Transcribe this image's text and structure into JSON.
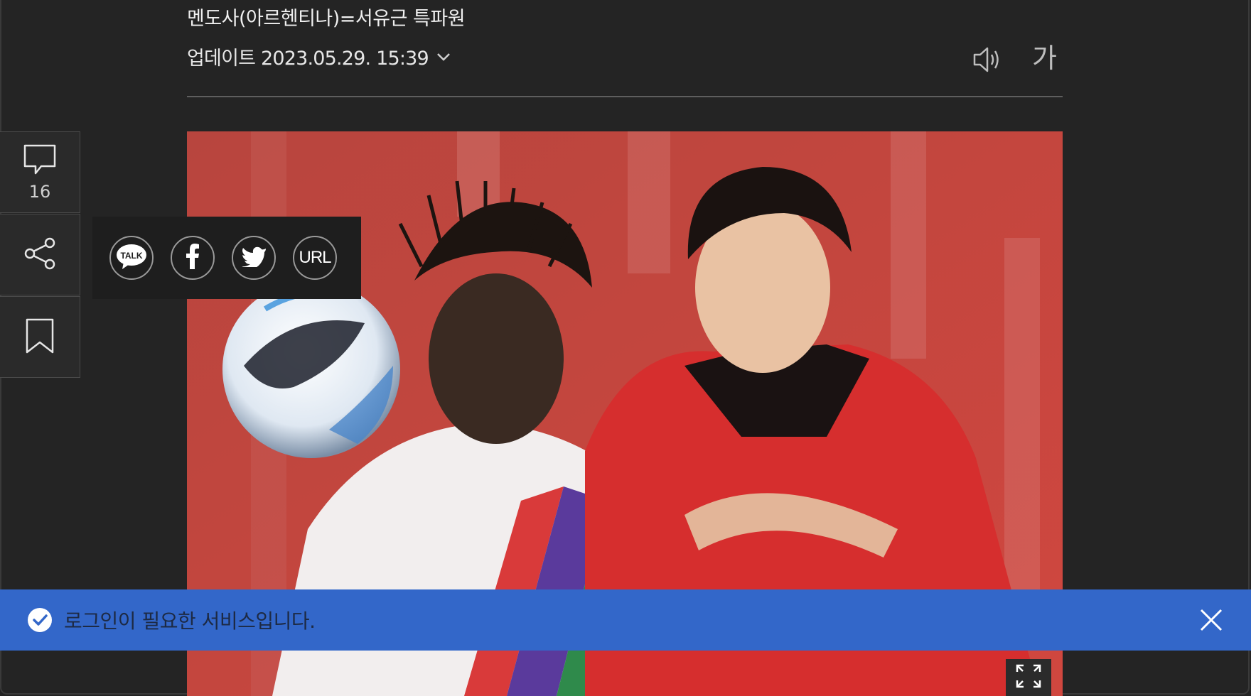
{
  "article": {
    "byline": "멘도사(아르헨티나)=서유근 특파원",
    "updated_label": "업데이트 2023.05.29. 15:39",
    "font_size_button": "가"
  },
  "side_rail": {
    "comment_count": "16",
    "icons": [
      "comment-icon",
      "share-icon",
      "bookmark-icon"
    ]
  },
  "share_popup": {
    "kakao_label": "TALK",
    "url_label": "URL",
    "icons": [
      "kakaotalk-icon",
      "facebook-icon",
      "twitter-icon"
    ]
  },
  "toast": {
    "message": "로그인이 필요한 서비스입니다.",
    "icons": [
      "check-circle-icon",
      "close-icon"
    ]
  },
  "photo": {
    "description_icons": [
      "expand-icon"
    ]
  },
  "colors": {
    "background": "#242424",
    "toast_blue": "#3367c9",
    "photo_red": "#c4433c"
  }
}
